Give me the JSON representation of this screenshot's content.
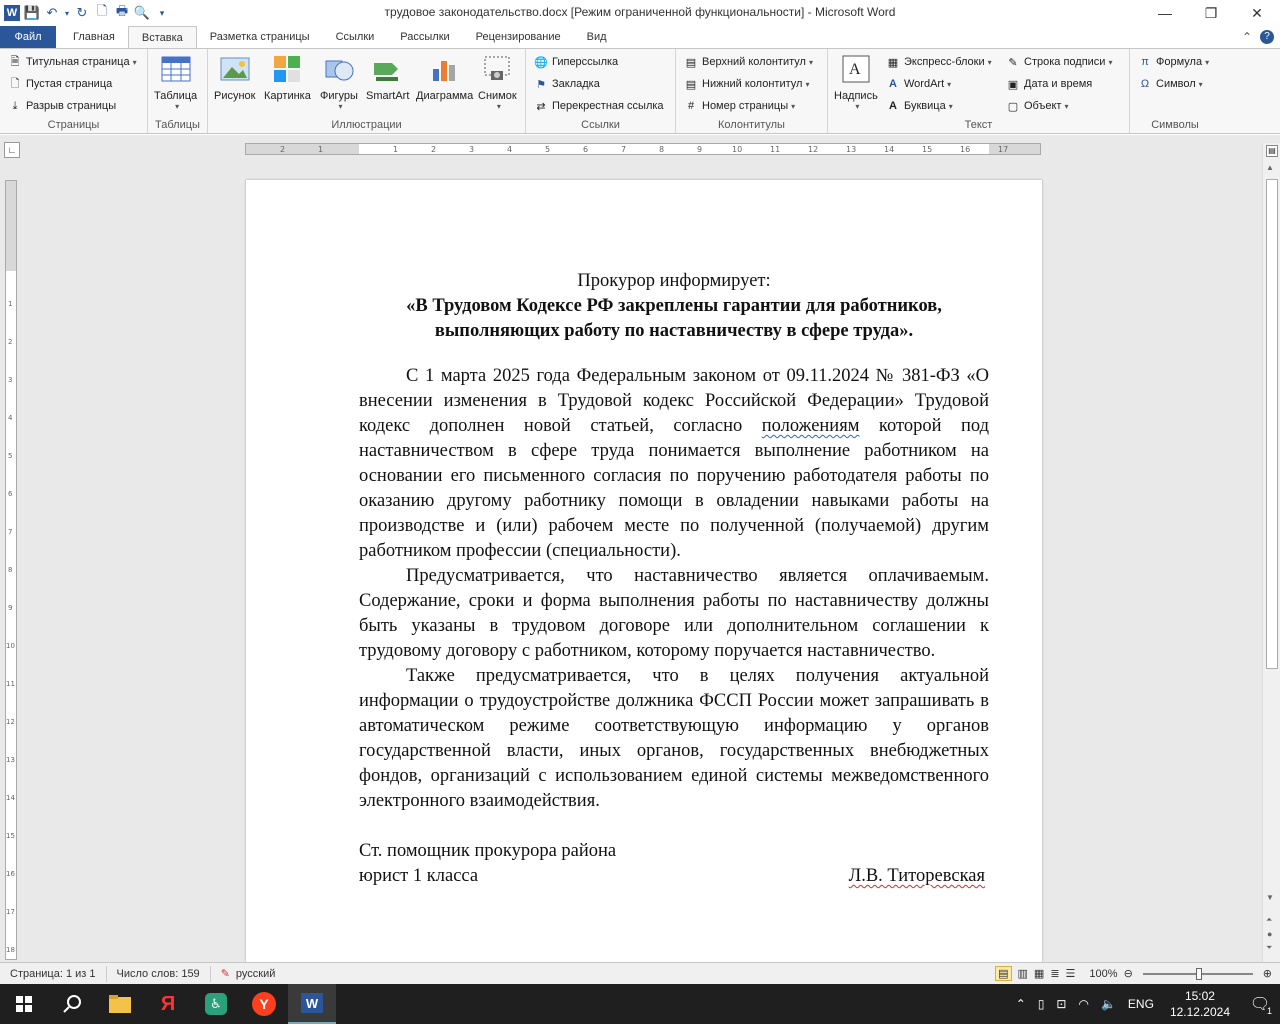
{
  "window": {
    "title": "трудовое законодательство.docx [Режим ограниченной функциональности]  -  Microsoft Word"
  },
  "tabs": [
    "Файл",
    "Главная",
    "Вставка",
    "Разметка страницы",
    "Ссылки",
    "Рассылки",
    "Рецензирование",
    "Вид"
  ],
  "ribbon": {
    "pages": {
      "label": "Страницы",
      "items": [
        "Титульная страница",
        "Пустая страница",
        "Разрыв страницы"
      ]
    },
    "tables": {
      "label": "Таблицы",
      "table": "Таблица"
    },
    "illustrations": {
      "label": "Иллюстрации",
      "items": [
        "Рисунок",
        "Картинка",
        "Фигуры",
        "SmartArt",
        "Диаграмма",
        "Снимок"
      ]
    },
    "links": {
      "label": "Ссылки",
      "items": [
        "Гиперссылка",
        "Закладка",
        "Перекрестная ссылка"
      ]
    },
    "headers": {
      "label": "Колонтитулы",
      "items": [
        "Верхний колонтитул",
        "Нижний колонтитул",
        "Номер страницы"
      ]
    },
    "text": {
      "label": "Текст",
      "textbox": "Надпись",
      "col1": [
        "Экспресс-блоки",
        "WordArt",
        "Буквица"
      ],
      "col2": [
        "Строка подписи",
        "Дата и время",
        "Объект"
      ]
    },
    "symbols": {
      "label": "Символы",
      "items": [
        "Формула",
        "Символ"
      ]
    }
  },
  "document": {
    "heading": "Прокурор информирует:",
    "title_line1": "«В Трудовом Кодексе РФ закреплены гарантии для работников,",
    "title_line2": "выполняющих работу по наставничеству в сфере труда».",
    "p1_a": "С 1 марта 2025 года Федеральным законом от 09.11.2024 № 381-ФЗ «О внесении изменения в Трудовой кодекс Российской Федерации» Трудовой кодекс дополнен новой статьей, согласно ",
    "p1_b": "положениям",
    "p1_c": " которой под наставничеством в сфере труда понимается выполнение работником на основании его письменного согласия по поручению работодателя работы по оказанию другому работнику помощи в овладении навыками работы на производстве и (или) рабочем месте по полученной (получаемой) другим работником профессии (специальности).",
    "p2": "Предусматривается, что наставничество является оплачиваемым. Содержание, сроки и форма выполнения работы по наставничеству должны быть указаны в трудовом договоре или дополнительном соглашении к трудовому договору с работником, которому поручается наставничество.",
    "p3": "Также предусматривается, что в целях получения актуальной информации о трудоустройстве должника ФССП России может запрашивать в автоматическом режиме соответствующую информацию у органов государственной власти, иных органов, государственных внебюджетных фондов, организаций с использованием единой системы межведомственного электронного взаимодействия.",
    "sig_line1": "Ст. помощник прокурора района",
    "sig_line2": "юрист 1 класса",
    "sig_name": "Л.В. Титоревская"
  },
  "statusbar": {
    "page": "Страница: 1 из 1",
    "words": "Число слов: 159",
    "language": "русский",
    "zoom": "100%"
  },
  "taskbar": {
    "lang": "ENG",
    "time": "15:02",
    "date": "12.12.2024",
    "notifications": "1"
  }
}
